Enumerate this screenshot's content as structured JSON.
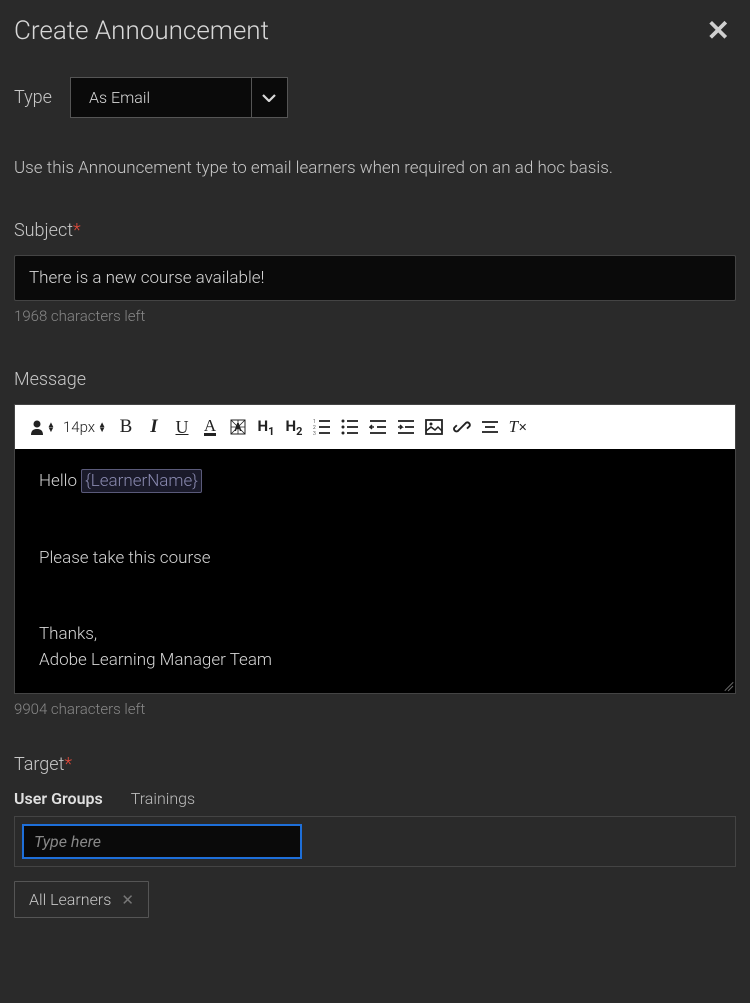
{
  "header": {
    "title": "Create Announcement"
  },
  "type": {
    "label": "Type",
    "selected": "As Email",
    "description": "Use this Announcement type to email learners when required on an ad hoc basis."
  },
  "subject": {
    "label": "Subject",
    "value": "There is a new course available!",
    "chars_left": "1968 characters left"
  },
  "message": {
    "label": "Message",
    "font_size": "14px",
    "body": {
      "greeting_prefix": "Hello ",
      "placeholder_token": "{LearnerName}",
      "line2": "Please take this course",
      "signoff1": "Thanks,",
      "signoff2": "Adobe Learning Manager Team"
    },
    "chars_left": "9904 characters left"
  },
  "target": {
    "label": "Target",
    "tabs": {
      "user_groups": "User Groups",
      "trainings": "Trainings"
    },
    "input_placeholder": "Type here",
    "chips": {
      "all_learners": "All Learners"
    }
  }
}
